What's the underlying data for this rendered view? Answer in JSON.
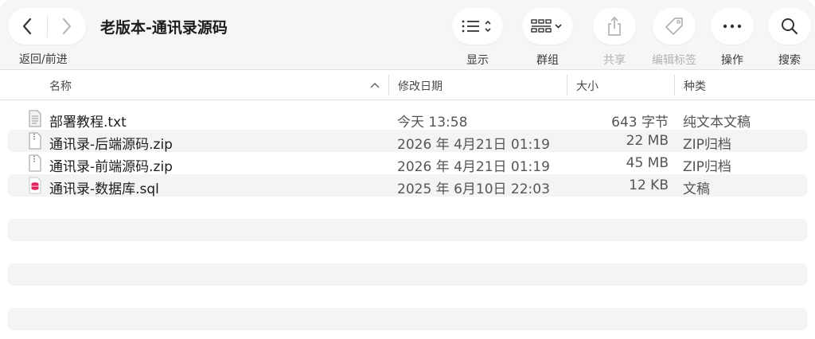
{
  "window": {
    "title": "老版本-通讯录源码",
    "nav_label": "返回/前进"
  },
  "toolbar": {
    "view_label": "显示",
    "group_label": "群组",
    "share_label": "共享",
    "tags_label": "编辑标签",
    "action_label": "操作",
    "search_label": "搜索"
  },
  "columns": {
    "name": "名称",
    "date": "修改日期",
    "size": "大小",
    "kind": "种类",
    "sort": "ascending"
  },
  "files": [
    {
      "name": "部署教程.txt",
      "date": "今天 13:58",
      "size": "643 字节",
      "kind": "纯文本文稿",
      "icon": "text-file-icon"
    },
    {
      "name": "通讯录-后端源码.zip",
      "date": "2026 年 4月21日 01:19",
      "size": "22 MB",
      "kind": "ZIP归档",
      "icon": "zip-file-icon"
    },
    {
      "name": "通讯录-前端源码.zip",
      "date": "2026 年 4月21日 01:19",
      "size": "45 MB",
      "kind": "ZIP归档",
      "icon": "zip-file-icon"
    },
    {
      "name": "通讯录-数据库.sql",
      "date": "2025 年 6月10日 22:03",
      "size": "12 KB",
      "kind": "文稿",
      "icon": "database-file-icon"
    }
  ],
  "colors": {
    "toolbar_bg": "#f6f6f6",
    "stripe": "#f4f4f5",
    "sql_icon": "#e0245e"
  }
}
